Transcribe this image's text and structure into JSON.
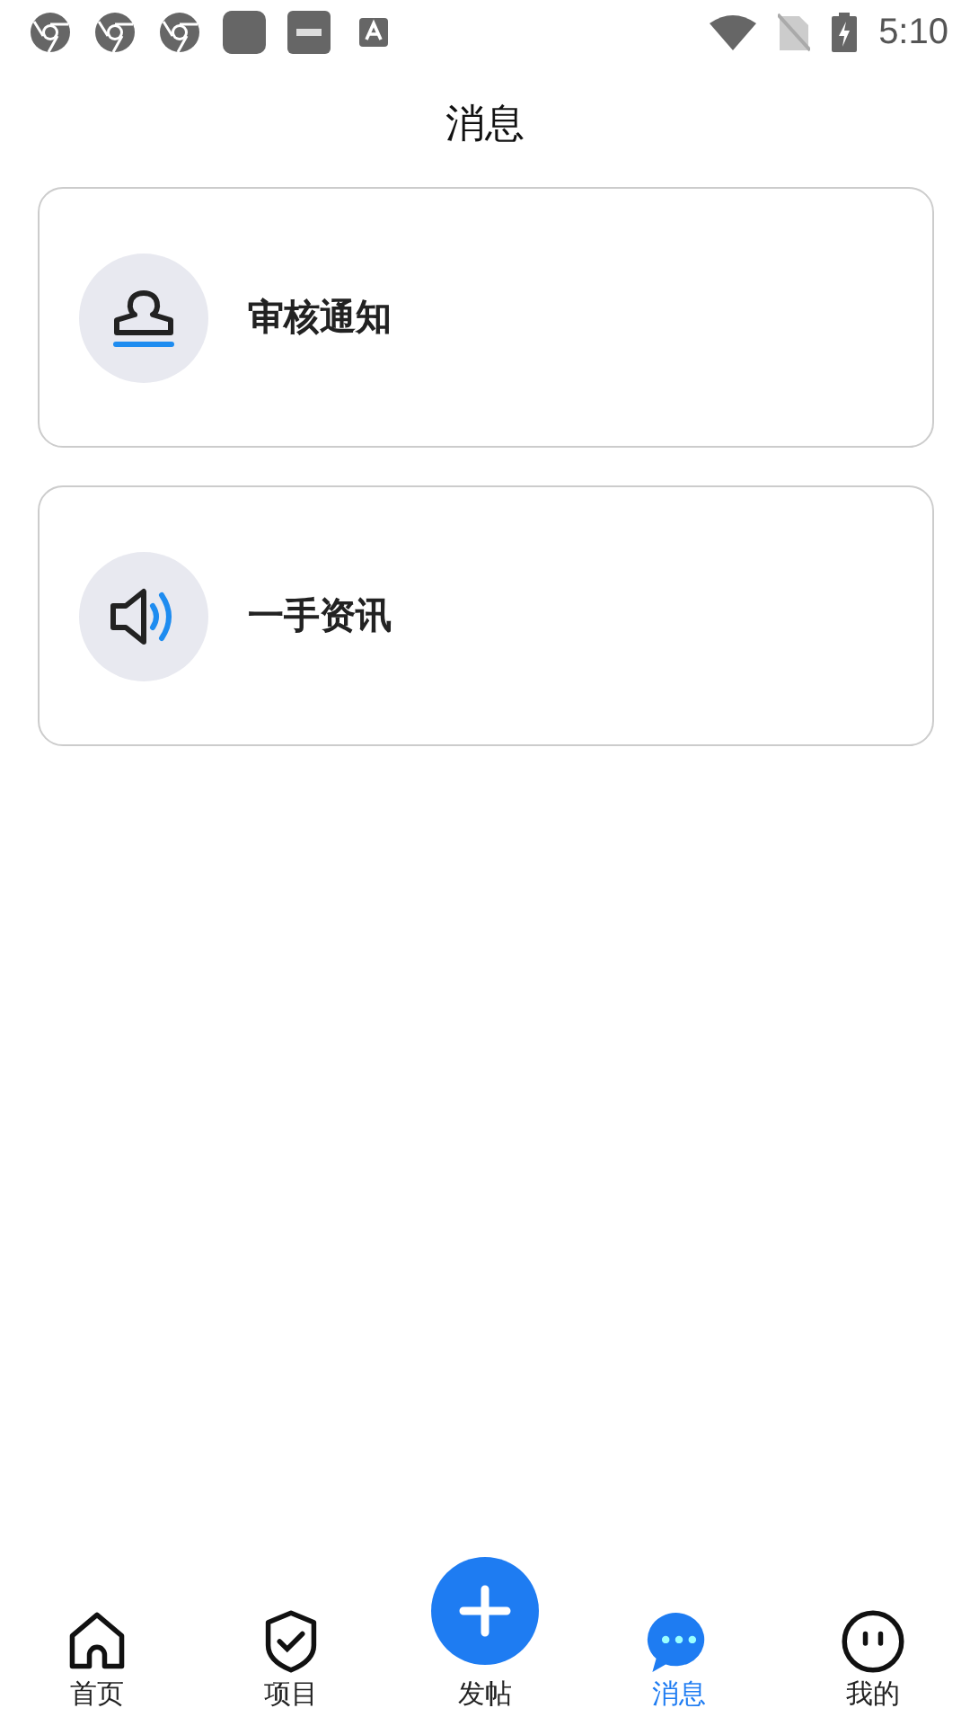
{
  "status_bar": {
    "time": "5:10"
  },
  "header": {
    "title": "消息"
  },
  "cards": [
    {
      "kind": "stamp",
      "label": "审核通知"
    },
    {
      "kind": "speaker",
      "label": "一手资讯"
    }
  ],
  "tab_bar": [
    {
      "kind": "home",
      "label": "首页",
      "selected": false
    },
    {
      "kind": "shield",
      "label": "项目",
      "selected": false
    },
    {
      "kind": "post",
      "label": "发帖",
      "selected": false
    },
    {
      "kind": "chat",
      "label": "消息",
      "selected": true
    },
    {
      "kind": "face",
      "label": "我的",
      "selected": false
    }
  ]
}
